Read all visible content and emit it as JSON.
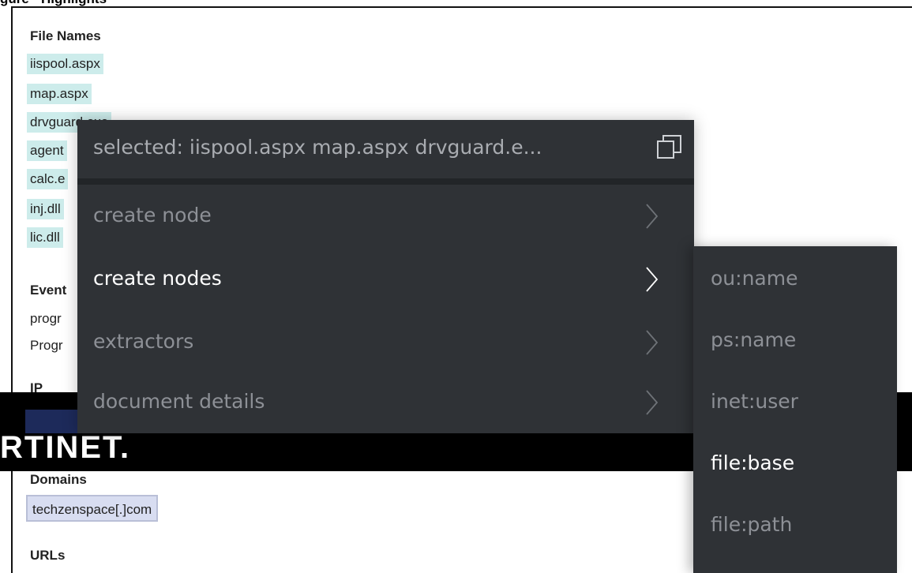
{
  "header_clip": "gure · Highlights",
  "file_names": {
    "title": "File Names",
    "items": [
      "iispool.aspx",
      "map.aspx",
      "drvguard.exe",
      "agent",
      "calc.e",
      "inj.dll",
      "lic.dll"
    ]
  },
  "events": {
    "title": "Event",
    "items": [
      "progr",
      "Progr"
    ]
  },
  "ips_clip": "IP",
  "banner_logo": "RTINET.",
  "domains": {
    "title": "Domains",
    "items": [
      "techzenspace[.]com"
    ]
  },
  "urls_title": "URLs",
  "menu": {
    "header": "selected: iispool.aspx map.aspx drvguard.e...",
    "copy_icon": "copy-icon",
    "items": [
      {
        "label": "create node",
        "active": false
      },
      {
        "label": "create nodes",
        "active": true
      },
      {
        "label": "extractors",
        "active": false
      },
      {
        "label": "document details",
        "active": false
      }
    ]
  },
  "submenu": {
    "items": [
      {
        "label": "ou:name",
        "active": false
      },
      {
        "label": "ps:name",
        "active": false
      },
      {
        "label": "inet:user",
        "active": false
      },
      {
        "label": "file:base",
        "active": true
      },
      {
        "label": "file:path",
        "active": false
      }
    ]
  },
  "colors": {
    "menu_bg": "#2f3236",
    "highlight_file": "#cdeceb",
    "highlight_domain": "#d8ddf1"
  }
}
